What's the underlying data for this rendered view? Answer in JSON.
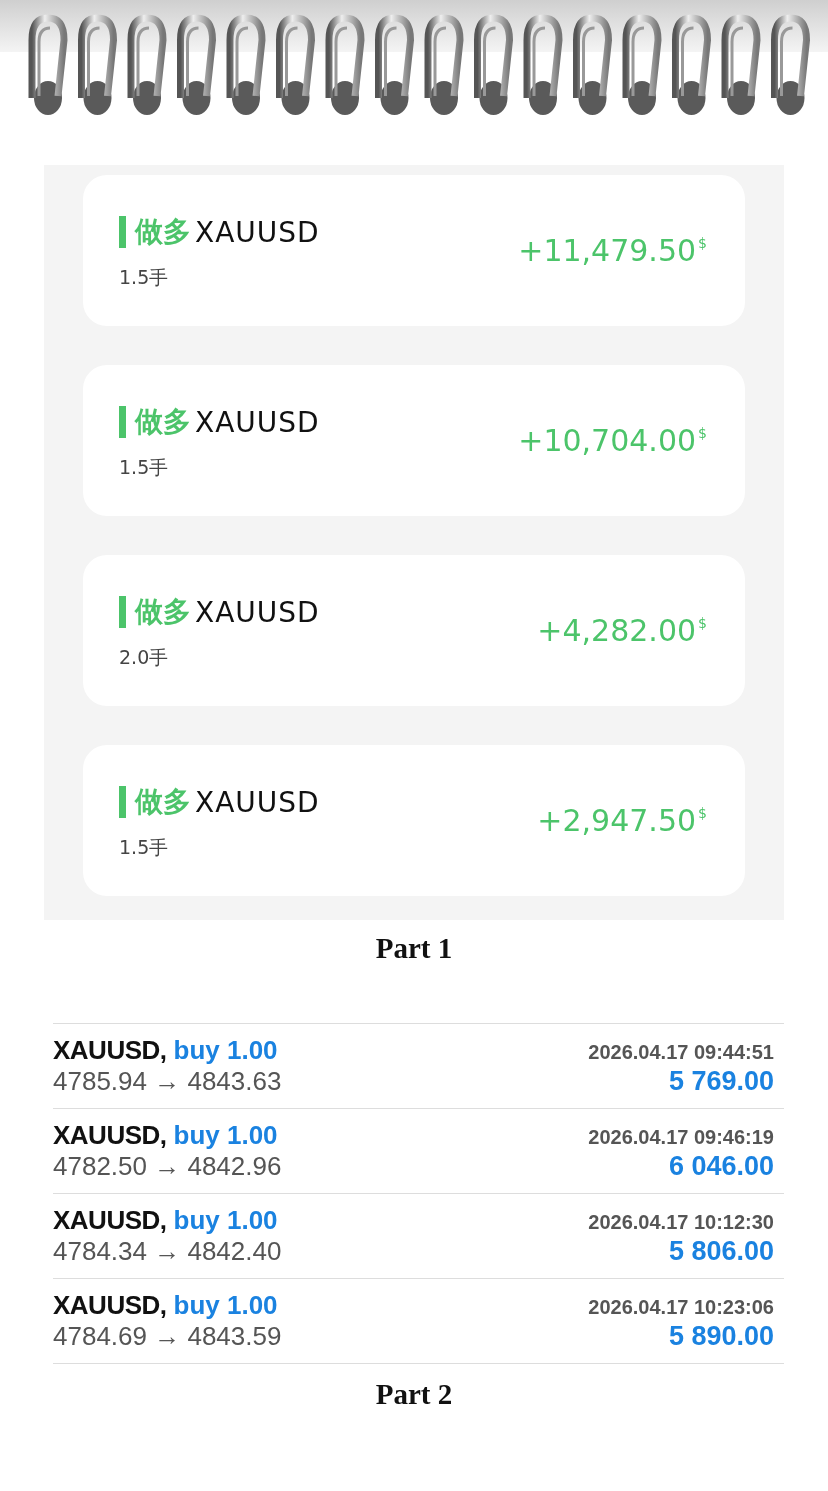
{
  "part1": {
    "cards": [
      {
        "direction": "做多",
        "symbol": "XAUUSD",
        "lots": "1.5手",
        "profit": "+11,479.50",
        "currency": "$"
      },
      {
        "direction": "做多",
        "symbol": "XAUUSD",
        "lots": "1.5手",
        "profit": "+10,704.00",
        "currency": "$"
      },
      {
        "direction": "做多",
        "symbol": "XAUUSD",
        "lots": "2.0手",
        "profit": "+4,282.00",
        "currency": "$"
      },
      {
        "direction": "做多",
        "symbol": "XAUUSD",
        "lots": "1.5手",
        "profit": "+2,947.50",
        "currency": "$"
      }
    ],
    "caption": "Part 1"
  },
  "part2": {
    "trades": [
      {
        "symbol": "XAUUSD,",
        "order": "buy 1.00",
        "prices": "4785.94 → 4843.63",
        "time": "2026.04.17 09:44:51",
        "profit": "5 769.00"
      },
      {
        "symbol": "XAUUSD,",
        "order": "buy 1.00",
        "prices": "4782.50 → 4842.96",
        "time": "2026.04.17 09:46:19",
        "profit": "6 046.00"
      },
      {
        "symbol": "XAUUSD,",
        "order": "buy 1.00",
        "prices": "4784.34 → 4842.40",
        "time": "2026.04.17 10:12:30",
        "profit": "5 806.00"
      },
      {
        "symbol": "XAUUSD,",
        "order": "buy 1.00",
        "prices": "4784.69 → 4843.59",
        "time": "2026.04.17 10:23:06",
        "profit": "5 890.00"
      }
    ],
    "caption": "Part 2"
  }
}
